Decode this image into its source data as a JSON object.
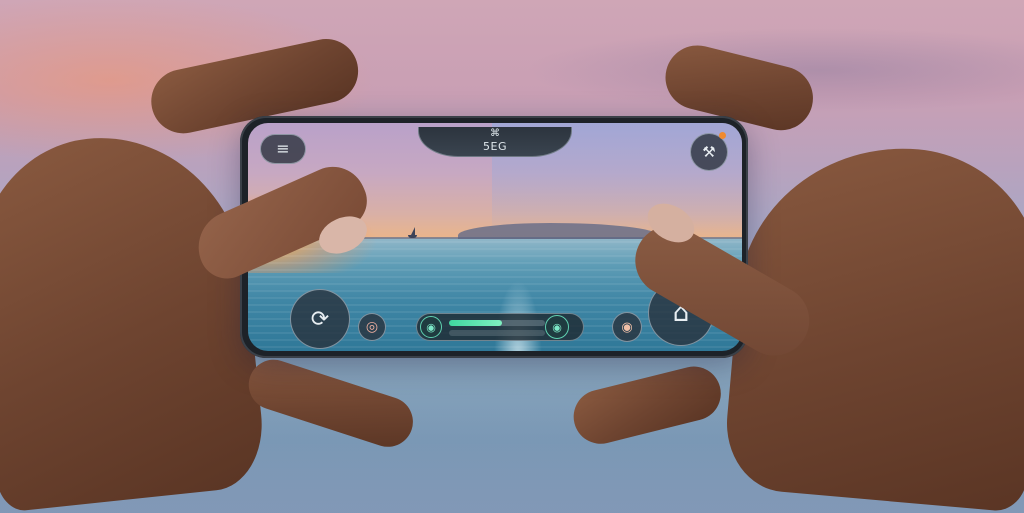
{
  "scene": {
    "description_colors": {
      "sky_top": "#b9a1c9",
      "sunset": "#e9b58c",
      "sea": "#3f86a5",
      "hud_dark": "#28303a",
      "accent_teal": "#3fd6a0",
      "notification": "#f08a30"
    }
  },
  "hud": {
    "menu": {
      "icon": "hamburger-menu-icon",
      "glyph": "≡"
    },
    "banner": {
      "label": "5EG",
      "icon": "drone-icon",
      "glyph": "⌘"
    },
    "settings": {
      "icon": "wrench-settings-icon",
      "glyph": "⚒",
      "has_notification": true
    },
    "joystick": {
      "icon": "rotate-joystick-icon",
      "glyph": "⟳"
    },
    "action_small": {
      "icon": "record-icon",
      "glyph": "◎"
    },
    "speed": {
      "left_icon": "gauge-icon",
      "left_glyph": "◉",
      "right_icon": "throttle-icon",
      "right_glyph": "◉",
      "level": 0.55
    },
    "target": {
      "icon": "target-icon",
      "glyph": "◉"
    },
    "home": {
      "icon": "home-icon",
      "glyph": "⌂"
    }
  }
}
